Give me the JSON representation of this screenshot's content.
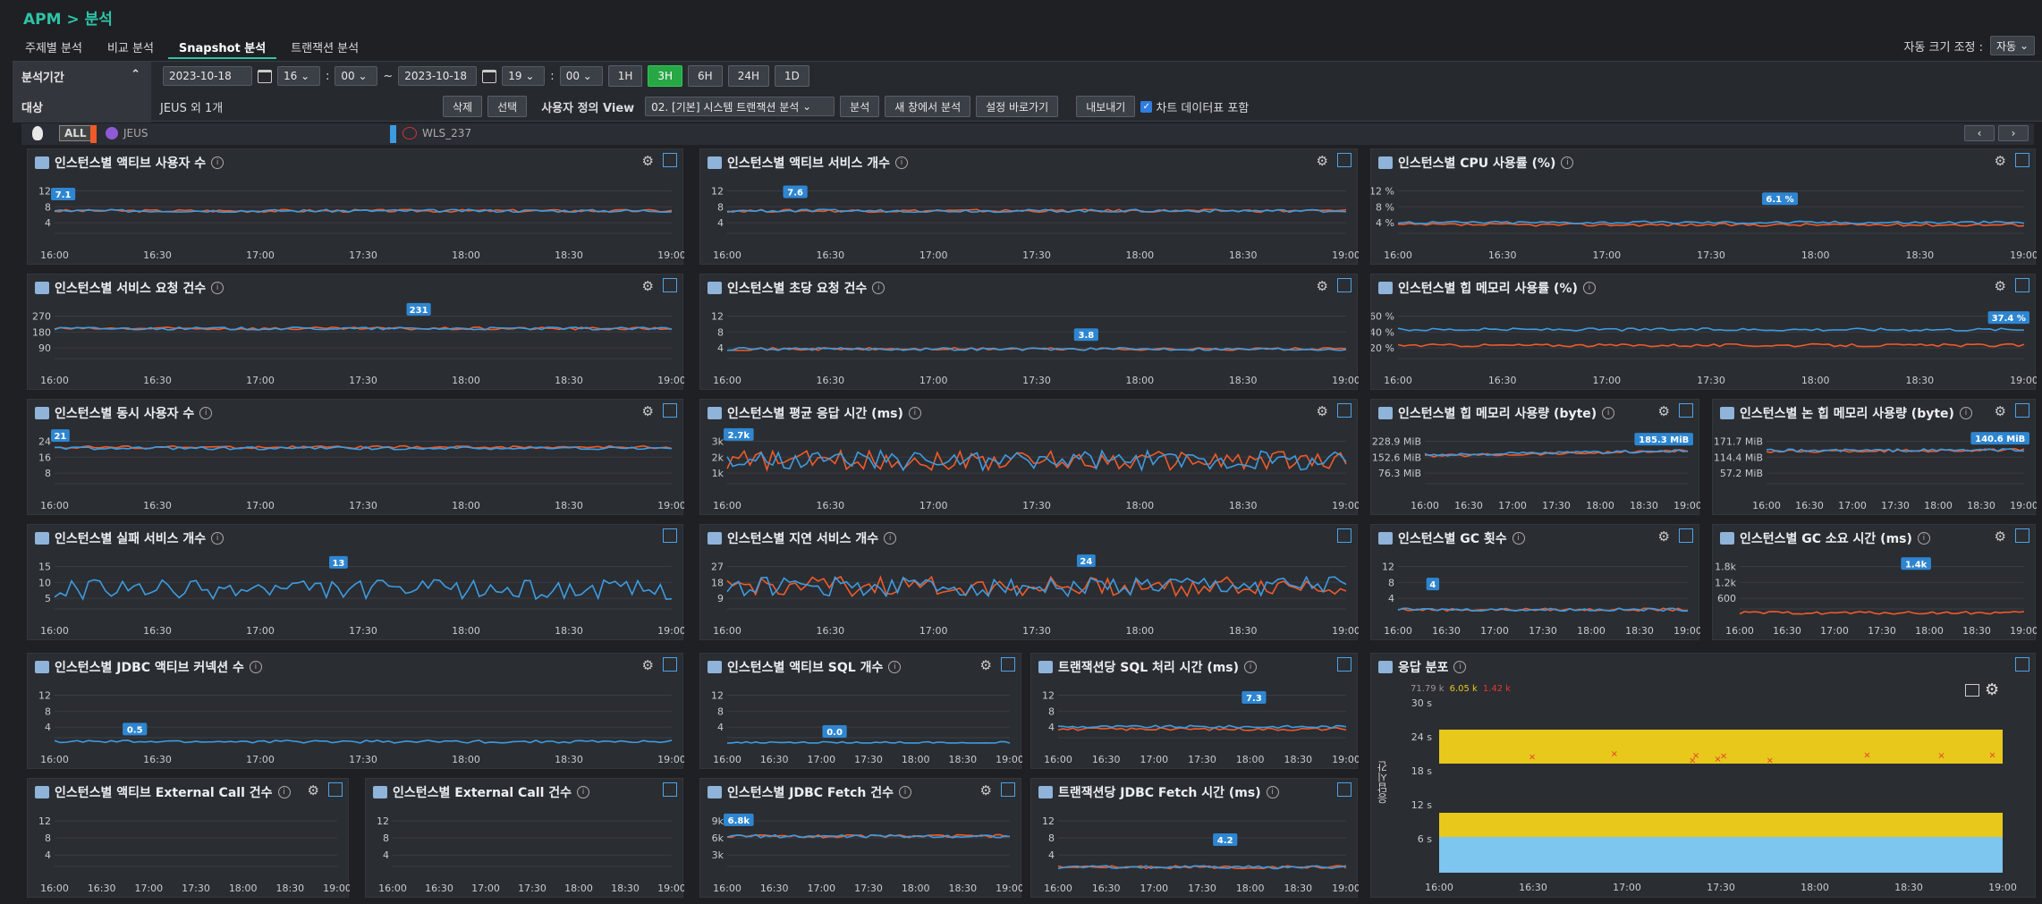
{
  "breadcrumb": "APM > 분석",
  "tabs": [
    {
      "label": "주제별 분석",
      "active": false
    },
    {
      "label": "비교 분석",
      "active": false
    },
    {
      "label": "Snapshot 분석",
      "active": true
    },
    {
      "label": "트랜잭션 분석",
      "active": false
    }
  ],
  "autosize": {
    "label": "자동 크기 조정 :",
    "value": "자동"
  },
  "filter": {
    "period_label": "분석기간",
    "start_date": "2023-10-18",
    "start_hour": "16",
    "start_min": "00",
    "tilde": "~",
    "end_date": "2023-10-18",
    "end_hour": "19",
    "end_min": "00",
    "ranges": [
      "1H",
      "3H",
      "6H",
      "24H",
      "1D"
    ],
    "active_range": "3H",
    "target_label": "대상",
    "target_value": "JEUS 외 1개",
    "delete_btn": "삭제",
    "select_btn": "선택",
    "view_label": "사용자 정의 View",
    "view_value": "02. [기본] 시스템 트랜잭션 분석",
    "analyze_btn": "분석",
    "new_window_btn": "새 창에서 분석",
    "shortcut_btn": "설정 바로가기",
    "export_btn": "내보내기",
    "include_chart_label": "차트 데이터표 포함",
    "include_chart_checked": true
  },
  "legend": {
    "all": "ALL",
    "items": [
      {
        "name": "JEUS",
        "color": "#f05a28"
      },
      {
        "name": "WLS_237",
        "color": "#3d9be0"
      }
    ]
  },
  "colors": {
    "series_a": "#f05a28",
    "series_b": "#3d9be0",
    "badge": "#2e86d1"
  },
  "scatter": {
    "title": "응답 분포",
    "counts": [
      "71.79 k",
      "6.05 k",
      "1.42 k"
    ],
    "ylabel": "응답시간",
    "yticks": [
      "30 s",
      "24 s",
      "18 s",
      "12 s",
      "6 s",
      ""
    ],
    "xticks": [
      "16:00",
      "16:30",
      "17:00",
      "17:30",
      "18:00",
      "18:30",
      "19:00"
    ]
  },
  "chart_data": [
    {
      "id": "p1",
      "type": "line",
      "title": "인스턴스별 액티브 사용자 수",
      "yticks": [
        "12",
        "8",
        "4"
      ],
      "ymax": 12,
      "series": [
        {
          "name": "JEUS",
          "values": [
            6,
            6,
            6,
            6,
            6
          ]
        },
        {
          "name": "WLS_237",
          "values": [
            6,
            6,
            6,
            6,
            6
          ]
        }
      ],
      "badge": "7.1",
      "badge_pos": 0.01,
      "badge_value": 7.1,
      "gear": true
    },
    {
      "id": "p2",
      "type": "line",
      "title": "인스턴스별 액티브 서비스 개수",
      "yticks": [
        "12",
        "8",
        "4"
      ],
      "ymax": 12,
      "series": [
        {
          "name": "JEUS",
          "values": [
            6,
            6,
            6,
            6,
            6
          ]
        },
        {
          "name": "WLS_237",
          "values": [
            6,
            6,
            6,
            6,
            6
          ]
        }
      ],
      "badge": "7.6",
      "badge_pos": 0.11,
      "badge_value": 7.6,
      "gear": true
    },
    {
      "id": "p3",
      "type": "line",
      "title": "인스턴스별 CPU 사용률 (%)",
      "yticks": [
        "12 %",
        "8 %",
        "4 %"
      ],
      "ymax": 12,
      "series": [
        {
          "name": "JEUS",
          "values": [
            3,
            3,
            3,
            3,
            3
          ]
        },
        {
          "name": "WLS_237",
          "values": [
            3.5,
            3.5,
            3.5,
            3.5,
            3.5
          ]
        }
      ],
      "badge": "6.1 %",
      "badge_pos": 0.61,
      "badge_value": 6.1,
      "gear": true
    },
    {
      "id": "p4",
      "type": "line",
      "title": "인스턴스별 서비스 요청 건수",
      "yticks": [
        "270",
        "180",
        "90"
      ],
      "ymax": 300,
      "series": [
        {
          "name": "JEUS",
          "values": [
            190,
            190,
            190,
            190,
            190
          ]
        },
        {
          "name": "WLS_237",
          "values": [
            190,
            190,
            190,
            190,
            190
          ]
        }
      ],
      "badge": "231",
      "badge_pos": 0.59,
      "badge_value": 231,
      "gear": true
    },
    {
      "id": "p5",
      "type": "line",
      "title": "인스턴스별 초당 요청 건수",
      "yticks": [
        "12",
        "8",
        "4"
      ],
      "ymax": 12,
      "series": [
        {
          "name": "JEUS",
          "values": [
            3.2,
            3.2,
            3.2,
            3.2,
            3.2
          ]
        },
        {
          "name": "WLS_237",
          "values": [
            3.2,
            3.2,
            3.2,
            3.2,
            3.2
          ]
        }
      ],
      "badge": "3.8",
      "badge_pos": 0.58,
      "badge_value": 3.8,
      "gear": true
    },
    {
      "id": "p6",
      "type": "line",
      "title": "인스턴스별 힙 메모리 사용률 (%)",
      "yticks": [
        "60 %",
        "40 %",
        "20 %"
      ],
      "ymax": 60,
      "series": [
        {
          "name": "JEUS",
          "values": [
            20,
            20,
            20,
            20,
            20
          ]
        },
        {
          "name": "WLS_237",
          "values": [
            37,
            37,
            37,
            37,
            37
          ]
        }
      ],
      "badge": "37.4 %",
      "badge_pos": 0.98,
      "badge_value": 37.4,
      "gear": true
    },
    {
      "id": "p7",
      "type": "line",
      "title": "인스턴스별 동시 사용자 수",
      "yticks": [
        "24",
        "16",
        "8"
      ],
      "ymax": 28,
      "series": [
        {
          "name": "JEUS",
          "values": [
            21,
            21,
            21,
            21,
            21
          ]
        },
        {
          "name": "WLS_237",
          "values": [
            20.5,
            20.5,
            20.5,
            20.5,
            20.5
          ]
        }
      ],
      "badge": "21",
      "badge_pos": 0.0,
      "badge_value": 21,
      "gear": true
    },
    {
      "id": "p8",
      "type": "line",
      "title": "인스턴스별 평균 응답 시간 (ms)",
      "yticks": [
        "3k",
        "2k",
        "1k"
      ],
      "ymax": 3500,
      "series": [
        {
          "name": "JEUS",
          "values": [
            1800,
            1800,
            1800,
            1800,
            1800
          ]
        },
        {
          "name": "WLS_237",
          "values": [
            1800,
            1800,
            1800,
            1800,
            1800
          ]
        }
      ],
      "badge": "2.7k",
      "badge_pos": 0.01,
      "badge_value": 2700,
      "gear": true
    },
    {
      "id": "p9",
      "type": "line",
      "title": "인스턴스별 힙 메모리 사용량 (byte)",
      "yticks": [
        "228.9 MiB",
        "152.6 MiB",
        "76.3 MiB"
      ],
      "ymax": 270,
      "series": [
        {
          "name": "JEUS",
          "values": [
            160,
            185
          ]
        },
        {
          "name": "WLS_237",
          "values": [
            165,
            185
          ]
        }
      ],
      "badge": "185.3 MiB",
      "badge_pos": 0.98,
      "badge_value": 185.3,
      "gear": true
    },
    {
      "id": "p10",
      "type": "line",
      "title": "인스턴스별 논 힙 메모리 사용량 (byte)",
      "yticks": [
        "171.7 MiB",
        "114.4 MiB",
        "57.2 MiB"
      ],
      "ymax": 200,
      "series": [
        {
          "name": "JEUS",
          "values": [
            135,
            140
          ]
        },
        {
          "name": "WLS_237",
          "values": [
            138,
            140
          ]
        }
      ],
      "badge": "140.6 MiB",
      "badge_pos": 0.98,
      "badge_value": 140.6,
      "gear": true
    },
    {
      "id": "p11",
      "type": "line",
      "title": "인스턴스별 실패 서비스 개수",
      "yticks": [
        "15",
        "10",
        "5"
      ],
      "ymax": 18,
      "series": [
        {
          "name": "WLS_237",
          "values": [
            8,
            8,
            8,
            8,
            8
          ]
        }
      ],
      "badge": "13",
      "badge_pos": 0.46,
      "badge_value": 13,
      "gear": false
    },
    {
      "id": "p12",
      "type": "line",
      "title": "인스턴스별 지연 서비스 개수",
      "yticks": [
        "27",
        "18",
        "9"
      ],
      "ymax": 32,
      "series": [
        {
          "name": "JEUS",
          "values": [
            16,
            16,
            16,
            16,
            16
          ]
        },
        {
          "name": "WLS_237",
          "values": [
            16,
            16,
            16,
            16,
            16
          ]
        }
      ],
      "badge": "24",
      "badge_pos": 0.58,
      "badge_value": 24,
      "gear": false
    },
    {
      "id": "p13",
      "type": "line",
      "title": "인스턴스별 GC 횟수",
      "yticks": [
        "12",
        "8",
        "4"
      ],
      "ymax": 12,
      "series": [
        {
          "name": "JEUS",
          "values": [
            1,
            1,
            1,
            1,
            1
          ]
        },
        {
          "name": "WLS_237",
          "values": [
            1,
            1,
            1,
            1,
            1
          ]
        }
      ],
      "badge": "4",
      "badge_pos": 0.12,
      "badge_value": 4,
      "gear": true
    },
    {
      "id": "p14",
      "type": "line",
      "title": "인스턴스별 GC 소요 시간 (ms)",
      "yticks": [
        "1.8k",
        "1.2k",
        "600"
      ],
      "ymax": 2000,
      "series": [
        {
          "name": "JEUS",
          "values": [
            50,
            50,
            50,
            50,
            50
          ]
        }
      ],
      "badge": "1.4k",
      "badge_pos": 0.62,
      "badge_value": 1400,
      "gear": true
    },
    {
      "id": "p15",
      "type": "line",
      "title": "인스턴스별 JDBC 액티브 커넥션 수",
      "yticks": [
        "12",
        "8",
        "4"
      ],
      "ymax": 12,
      "series": [
        {
          "name": "WLS_237",
          "values": [
            0.3,
            0.3,
            0.3,
            0.3,
            0.3
          ]
        }
      ],
      "badge": "0.5",
      "badge_pos": 0.13,
      "badge_value": 0.5,
      "gear": true
    },
    {
      "id": "p16",
      "type": "line",
      "title": "인스턴스별 액티브 SQL 개수",
      "yticks": [
        "12",
        "8",
        "4"
      ],
      "ymax": 12,
      "series": [
        {
          "name": "WLS_237",
          "values": [
            0,
            0,
            0,
            0,
            0
          ]
        }
      ],
      "badge": "0.0",
      "badge_pos": 0.38,
      "badge_value": 0,
      "gear": true
    },
    {
      "id": "p17",
      "type": "line",
      "title": "트랜잭션당 SQL 처리 시간 (ms)",
      "yticks": [
        "12",
        "8",
        "4"
      ],
      "ymax": 12,
      "series": [
        {
          "name": "JEUS",
          "values": [
            3,
            3,
            3,
            3,
            3
          ]
        },
        {
          "name": "WLS_237",
          "values": [
            3.5,
            3.5,
            3.5,
            3.5,
            3.5
          ]
        }
      ],
      "badge": "7.3",
      "badge_pos": 0.68,
      "badge_value": 7.3,
      "gear": false
    },
    {
      "id": "p18",
      "type": "line",
      "title": "인스턴스별 액티브 External Call 건수",
      "yticks": [
        "12",
        "8",
        "4"
      ],
      "ymax": 12,
      "series": [],
      "badge": "",
      "gear": true
    },
    {
      "id": "p19",
      "type": "line",
      "title": "인스턴스별 External Call 건수",
      "yticks": [
        "12",
        "8",
        "4"
      ],
      "ymax": 12,
      "series": [],
      "badge": "",
      "gear": false
    },
    {
      "id": "p20",
      "type": "line",
      "title": "인스턴스별 JDBC Fetch 건수",
      "yticks": [
        "9k",
        "6k",
        "3k"
      ],
      "ymax": 10000,
      "series": [
        {
          "name": "JEUS",
          "values": [
            6000,
            6000,
            6000,
            6000,
            6000
          ]
        },
        {
          "name": "WLS_237",
          "values": [
            6000,
            6000,
            6000,
            6000,
            6000
          ]
        }
      ],
      "badge": "6.8k",
      "badge_pos": 0.0,
      "badge_value": 6800,
      "gear": true
    },
    {
      "id": "p21",
      "type": "line",
      "title": "트랜잭션당 JDBC Fetch 시간 (ms)",
      "yticks": [
        "12",
        "8",
        "4"
      ],
      "ymax": 12,
      "series": [
        {
          "name": "JEUS",
          "values": [
            1,
            1,
            1,
            1,
            1
          ]
        },
        {
          "name": "WLS_237",
          "values": [
            1,
            1,
            1,
            1,
            1
          ]
        }
      ],
      "badge": "4.2",
      "badge_pos": 0.58,
      "badge_value": 4.2,
      "gear": false
    }
  ],
  "xticks": [
    "16:00",
    "16:30",
    "17:00",
    "17:30",
    "18:00",
    "18:30",
    "19:00"
  ]
}
